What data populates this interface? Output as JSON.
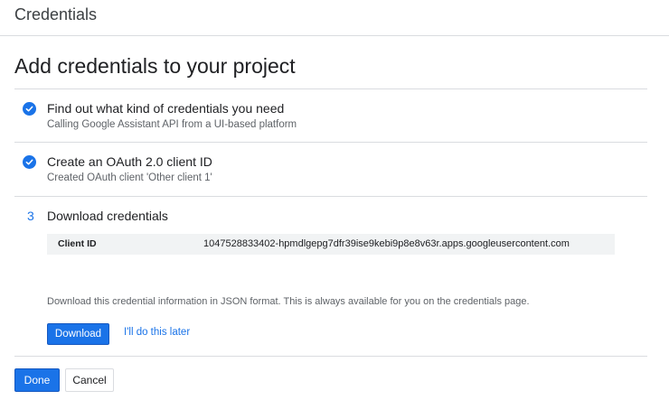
{
  "header": {
    "title": "Credentials"
  },
  "page": {
    "title": "Add credentials to your project"
  },
  "steps": [
    {
      "status": "complete",
      "icon": "check-circle-icon",
      "title": "Find out what kind of credentials you need",
      "subtitle": "Calling Google Assistant API from a UI-based platform"
    },
    {
      "status": "complete",
      "icon": "check-circle-icon",
      "title": "Create an OAuth 2.0 client ID",
      "subtitle": "Created OAuth client 'Other client 1'"
    },
    {
      "status": "current",
      "number": "3",
      "title": "Download credentials",
      "client_id_label": "Client ID",
      "client_id_value": "1047528833402-hpmdlgepg7dfr39ise9kebi9p8e8v63r.apps.googleusercontent.com",
      "note": "Download this credential information in JSON format. This is always available for you on the credentials page.",
      "download_label": "Download",
      "later_label": "I'll do this later"
    }
  ],
  "footer": {
    "done_label": "Done",
    "cancel_label": "Cancel"
  },
  "colors": {
    "accent": "#1a73e8",
    "divider": "#dadce0",
    "secondary_text": "#5f6368"
  }
}
